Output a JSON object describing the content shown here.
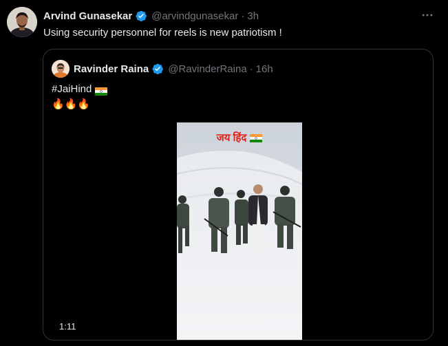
{
  "tweet": {
    "author_name": "Arvind Gunasekar",
    "handle": "@arvindgunasekar",
    "separator": "·",
    "time": "3h",
    "text": "Using security personnel for reels is new patriotism !"
  },
  "quoted": {
    "author_name": "Ravinder Raina",
    "handle": "@RavinderRaina",
    "separator": "·",
    "time": "16h",
    "hashtag": "#JaiHind",
    "emojis": "🔥🔥🔥",
    "video_caption": "जय हिंद",
    "video_duration": "1:11"
  },
  "icons": {
    "verified": "verified-badge-icon",
    "more": "more-options-icon",
    "flag": "india-flag-icon"
  },
  "colors": {
    "background": "#000000",
    "text": "#e7e9ea",
    "muted": "#71767b",
    "verified": "#1d9bf0",
    "border": "#2f3336",
    "caption": "#e0201a"
  }
}
